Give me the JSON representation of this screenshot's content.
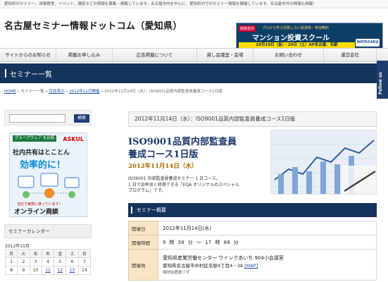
{
  "topstrip": {
    "text": "愛知県のセミナー、体験教室、イベント、講座などの情報を募集・掲載しています。名古屋市内を中心に、愛知県内でのセミナー情報を網羅しています。名古屋市外の情報も掲載！"
  },
  "header": {
    "site_title": "名古屋セミナー情報ドットコム（愛知県）",
    "banner": {
      "badge": "開催直前",
      "top": "プロから学ぶ失敗しない投資術｜参加無料",
      "main": "マンション投資スクール",
      "date": "10月19日（金）・20日（土）AP名古屋．名駅",
      "logo": "WATASAKU"
    }
  },
  "nav": {
    "items": [
      {
        "label": "サイトからのお知らせ"
      },
      {
        "label": "掲載お申し込み"
      },
      {
        "label": "広告掲載について"
      },
      {
        "label": "貸し会議室・会場"
      },
      {
        "label": "お問い合わせ"
      },
      {
        "label": "運営会社"
      }
    ]
  },
  "follow": {
    "label": "Follow us"
  },
  "section": {
    "title": "セミナー一覧"
  },
  "breadcrumb": {
    "home": "HOME",
    "sep": "»",
    "list": "セミナー一覧",
    "monthly": "月別表示",
    "month": "2012年11月開催",
    "current": "2012年11月14日（水）：ISO9001品質内部監査員養成コース1日版"
  },
  "sidebar": {
    "search": {
      "placeholder": "",
      "button": "検索"
    },
    "ad": {
      "badge": "グループウェア\nを比較",
      "logo": "ASKUL",
      "line1": "社内共有はとことん",
      "line2": "効率的に！",
      "cta_top": "当社で実際に使っています！",
      "cta": "オンライン商談"
    },
    "calendar": {
      "heading": "セミナーカレンダー",
      "month": "2012年10月",
      "weekdays": [
        "月",
        "火",
        "水",
        "木",
        "金",
        "土",
        "日"
      ],
      "weeks": [
        [
          "1",
          "2",
          "3",
          "4",
          "5",
          "6",
          "7"
        ],
        [
          "8",
          "9",
          "10",
          "11",
          "12",
          "13",
          "14"
        ]
      ],
      "linked": [
        "11",
        "12",
        "13"
      ]
    }
  },
  "event": {
    "header": "2012年11月14日（水）：ISO9001品質内部監査員養成コース1日版",
    "title_line1": "ISO9001品質内部監査員",
    "title_line2": "養成コース1日版",
    "date": "2012年11月14日（水）",
    "desc_line1": "ISO9001 内部監査員養成セミナー 1 日コース。",
    "desc_line2": "1 日で効率良く修得できる「EQA オリジナルのスペシャル",
    "desc_line3": "プログラム」です。",
    "overview_heading": "セミナー概要",
    "details": [
      {
        "label": "開催日",
        "value": "2012年11月14日(水)"
      },
      {
        "label": "開催時間",
        "value": "9 時 30 分 ～ 17 時 00 分"
      },
      {
        "label": "開催地",
        "value": "愛知県産業労働センター ウインクあいち 904小会議室",
        "address": "愛知県名古屋市中村区名駅4丁目4－38",
        "map": "[MAP]",
        "note": "現地在籍数少ず"
      }
    ]
  },
  "colors": {
    "navy": "#15335d",
    "label_bg": "#f8e5c5",
    "date_gold": "#a86a00",
    "link": "#1a4ea3"
  }
}
